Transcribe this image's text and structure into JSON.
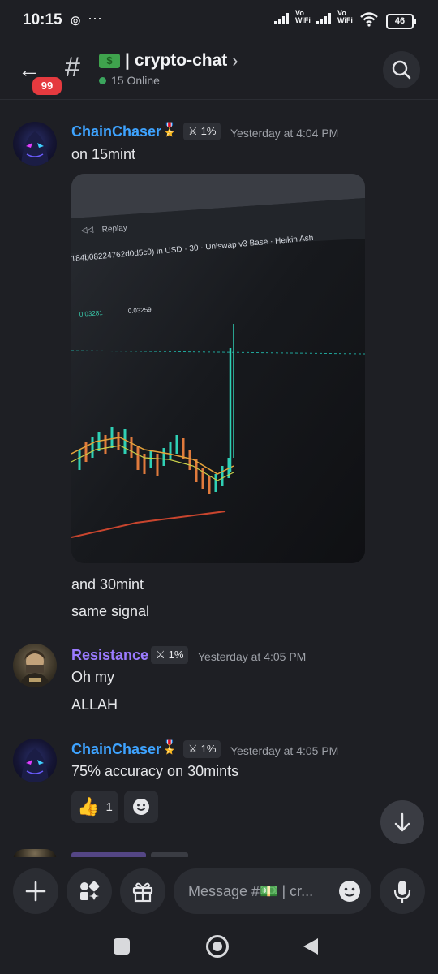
{
  "status_bar": {
    "time": "10:15",
    "net1": "Vo\nWiFi",
    "net1_a": "Vo",
    "net1_b": "WiFi",
    "net2_a": "Vo",
    "net2_b": "WiFi",
    "battery": "46"
  },
  "header": {
    "unread_badge": "99",
    "hash": "#",
    "channel_emoji": "$",
    "channel_name": "crypto-chat",
    "chevron": "›",
    "online_text": "15 Online"
  },
  "messages": [
    {
      "author": "ChainChaser",
      "role_label": "1%",
      "timestamp": "Yesterday at 4:04 PM",
      "lines": [
        "on 15mint",
        "and 30mint",
        "same signal"
      ]
    },
    {
      "author": "Resistance",
      "role_label": "1%",
      "timestamp": "Yesterday at 4:05 PM",
      "lines": [
        "Oh my",
        "ALLAH"
      ]
    },
    {
      "author": "ChainChaser",
      "role_label": "1%",
      "timestamp": "Yesterday at 4:05 PM",
      "lines": [
        "75% accuracy on 30mints"
      ],
      "reactions": [
        {
          "emoji": "👍",
          "count": "1"
        }
      ]
    }
  ],
  "chart_photo": {
    "toolbar_text": "Replay",
    "pair_text": "184b08224762d0d5c0) in USD · 30 · Uniswap v3 Base · Heikin Ash",
    "price1": "0.03281",
    "price2": "0.03259"
  },
  "composer": {
    "placeholder": "Message #💵 | cr..."
  },
  "colors": {
    "background": "#1e1f24",
    "chainchaser_name": "#3ea3ff",
    "resistance_name": "#9b7bff",
    "online_dot": "#3ba55d",
    "badge_red": "#e53a3f"
  }
}
